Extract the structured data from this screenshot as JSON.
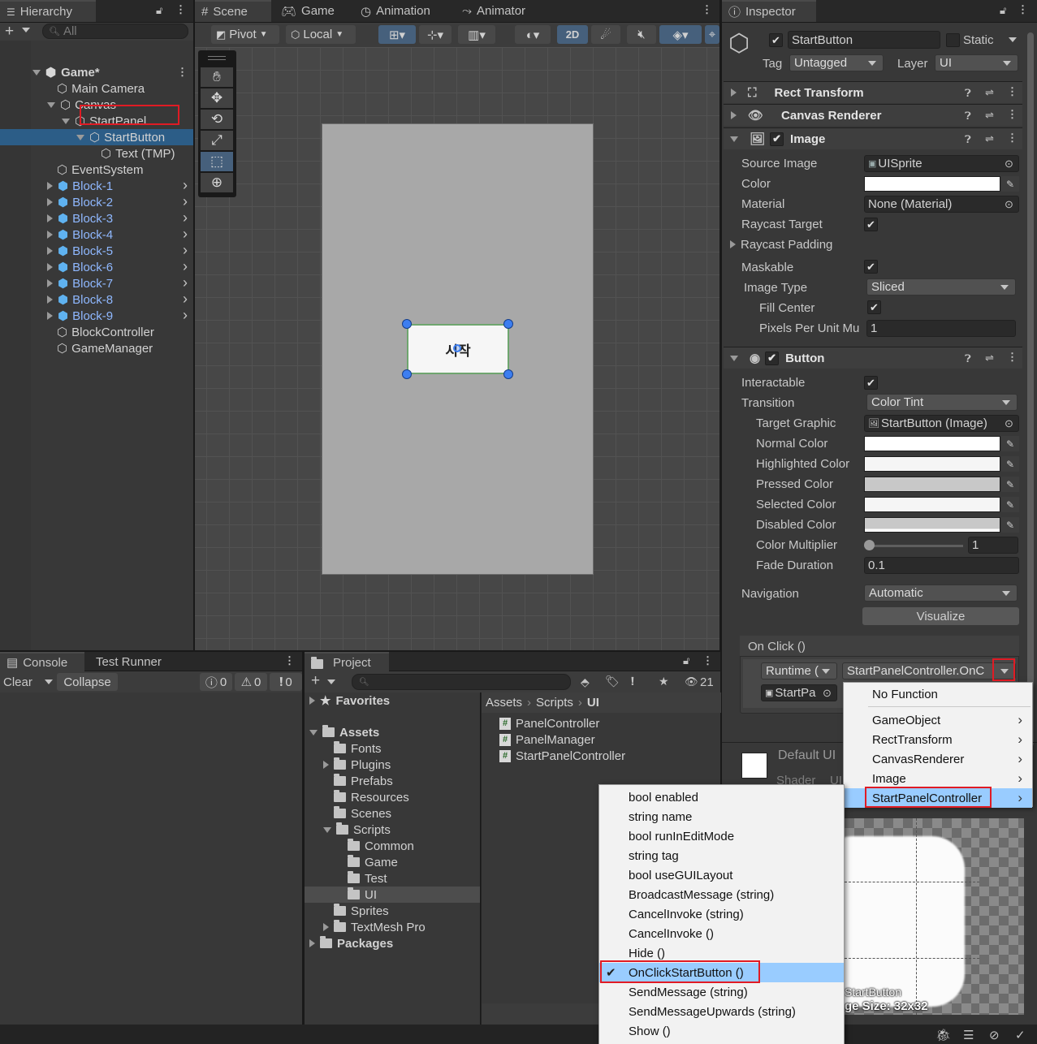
{
  "hierarchy": {
    "tab_label": "Hierarchy",
    "search_placeholder": "All",
    "scene_name": "Game*",
    "items": [
      {
        "label": "Main Camera",
        "indent": 1,
        "expander": "",
        "blue": false
      },
      {
        "label": "Canvas",
        "indent": 1,
        "expander": "down",
        "blue": false
      },
      {
        "label": "StartPanel",
        "indent": 2,
        "expander": "down",
        "blue": false
      },
      {
        "label": "StartButton",
        "indent": 3,
        "expander": "down",
        "blue": false,
        "selected": true
      },
      {
        "label": "Text (TMP)",
        "indent": 4,
        "expander": "",
        "blue": false
      },
      {
        "label": "EventSystem",
        "indent": 1,
        "expander": "",
        "blue": false
      },
      {
        "label": "Block-1",
        "indent": 1,
        "expander": "right",
        "blue": true
      },
      {
        "label": "Block-2",
        "indent": 1,
        "expander": "right",
        "blue": true
      },
      {
        "label": "Block-3",
        "indent": 1,
        "expander": "right",
        "blue": true
      },
      {
        "label": "Block-4",
        "indent": 1,
        "expander": "right",
        "blue": true
      },
      {
        "label": "Block-5",
        "indent": 1,
        "expander": "right",
        "blue": true
      },
      {
        "label": "Block-6",
        "indent": 1,
        "expander": "right",
        "blue": true
      },
      {
        "label": "Block-7",
        "indent": 1,
        "expander": "right",
        "blue": true
      },
      {
        "label": "Block-8",
        "indent": 1,
        "expander": "right",
        "blue": true
      },
      {
        "label": "Block-9",
        "indent": 1,
        "expander": "right",
        "blue": true
      },
      {
        "label": "BlockController",
        "indent": 1,
        "expander": "",
        "blue": false
      },
      {
        "label": "GameManager",
        "indent": 1,
        "expander": "",
        "blue": false
      }
    ]
  },
  "scene": {
    "tabs": [
      "Scene",
      "Game",
      "Animation",
      "Animator"
    ],
    "pivot_label": "Pivot",
    "local_label": "Local",
    "mode_2d": "2D",
    "button_text": "시작"
  },
  "inspector": {
    "tab_label": "Inspector",
    "object_name": "StartButton",
    "static_label": "Static",
    "tag_label": "Tag",
    "tag_value": "Untagged",
    "layer_label": "Layer",
    "layer_value": "UI",
    "components": {
      "rect_transform": "Rect Transform",
      "canvas_renderer": "Canvas Renderer",
      "image": "Image",
      "button": "Button"
    },
    "image_fields": {
      "source_image_label": "Source Image",
      "source_image_value": "UISprite",
      "color_label": "Color",
      "material_label": "Material",
      "material_value": "None (Material)",
      "raycast_target_label": "Raycast Target",
      "raycast_padding_label": "Raycast Padding",
      "maskable_label": "Maskable",
      "image_type_label": "Image Type",
      "image_type_value": "Sliced",
      "fill_center_label": "Fill Center",
      "ppu_label": "Pixels Per Unit Mu",
      "ppu_value": "1"
    },
    "button_fields": {
      "interactable_label": "Interactable",
      "transition_label": "Transition",
      "transition_value": "Color Tint",
      "target_graphic_label": "Target Graphic",
      "target_graphic_value": "StartButton (Image)",
      "normal_label": "Normal Color",
      "highlighted_label": "Highlighted Color",
      "pressed_label": "Pressed Color",
      "selected_label": "Selected Color",
      "disabled_label": "Disabled Color",
      "multiplier_label": "Color Multiplier",
      "multiplier_value": "1",
      "fade_label": "Fade Duration",
      "fade_value": "0.1",
      "navigation_label": "Navigation",
      "navigation_value": "Automatic",
      "visualize_label": "Visualize",
      "onclick_label": "On Click ()",
      "runtime_value": "Runtime (",
      "function_value": "StartPanelController.OnC",
      "object_value": "StartPa"
    },
    "material_preview": {
      "name": "Default UI",
      "shader_label": "Shader",
      "shader_value": "UI"
    },
    "preview": {
      "name": "StartButton",
      "size_text": "ge Size: 32x32"
    }
  },
  "component_menu": {
    "items": [
      {
        "label": "No Function",
        "arrow": false
      },
      {
        "label": "GameObject",
        "arrow": true
      },
      {
        "label": "RectTransform",
        "arrow": true
      },
      {
        "label": "CanvasRenderer",
        "arrow": true
      },
      {
        "label": "Image",
        "arrow": true
      },
      {
        "label": "StartPanelController",
        "arrow": true,
        "highlighted": true
      }
    ]
  },
  "method_menu": {
    "items": [
      {
        "label": "bool enabled"
      },
      {
        "label": "string name"
      },
      {
        "label": "bool runInEditMode"
      },
      {
        "label": "string tag"
      },
      {
        "label": "bool useGUILayout"
      },
      {
        "label": "BroadcastMessage (string)"
      },
      {
        "label": "CancelInvoke (string)"
      },
      {
        "label": "CancelInvoke ()"
      },
      {
        "label": "Hide ()"
      },
      {
        "label": "OnClickStartButton ()",
        "checked": true
      },
      {
        "label": "SendMessage (string)"
      },
      {
        "label": "SendMessageUpwards (string)"
      },
      {
        "label": "Show ()"
      }
    ]
  },
  "console": {
    "tab_label": "Console",
    "tab2_label": "Test Runner",
    "clear_label": "Clear",
    "collapse_label": "Collapse",
    "log_count": "0",
    "warn_count": "0",
    "error_count": "0"
  },
  "project": {
    "tab_label": "Project",
    "hidden_count": "21",
    "favorites_label": "Favorites",
    "tree": [
      {
        "label": "Assets",
        "indent": 0,
        "expander": "down",
        "bold": true
      },
      {
        "label": "Fonts",
        "indent": 1,
        "expander": ""
      },
      {
        "label": "Plugins",
        "indent": 1,
        "expander": "right"
      },
      {
        "label": "Prefabs",
        "indent": 1,
        "expander": ""
      },
      {
        "label": "Resources",
        "indent": 1,
        "expander": ""
      },
      {
        "label": "Scenes",
        "indent": 1,
        "expander": ""
      },
      {
        "label": "Scripts",
        "indent": 1,
        "expander": "down"
      },
      {
        "label": "Common",
        "indent": 2,
        "expander": ""
      },
      {
        "label": "Game",
        "indent": 2,
        "expander": ""
      },
      {
        "label": "Test",
        "indent": 2,
        "expander": ""
      },
      {
        "label": "UI",
        "indent": 2,
        "expander": "",
        "selected": true
      },
      {
        "label": "Sprites",
        "indent": 1,
        "expander": ""
      },
      {
        "label": "TextMesh Pro",
        "indent": 1,
        "expander": "right"
      },
      {
        "label": "Packages",
        "indent": 0,
        "expander": "right",
        "bold": true
      }
    ],
    "breadcrumb": [
      "Assets",
      "Scripts",
      "UI"
    ],
    "files": [
      "PanelController",
      "PanelManager",
      "StartPanelController"
    ]
  }
}
